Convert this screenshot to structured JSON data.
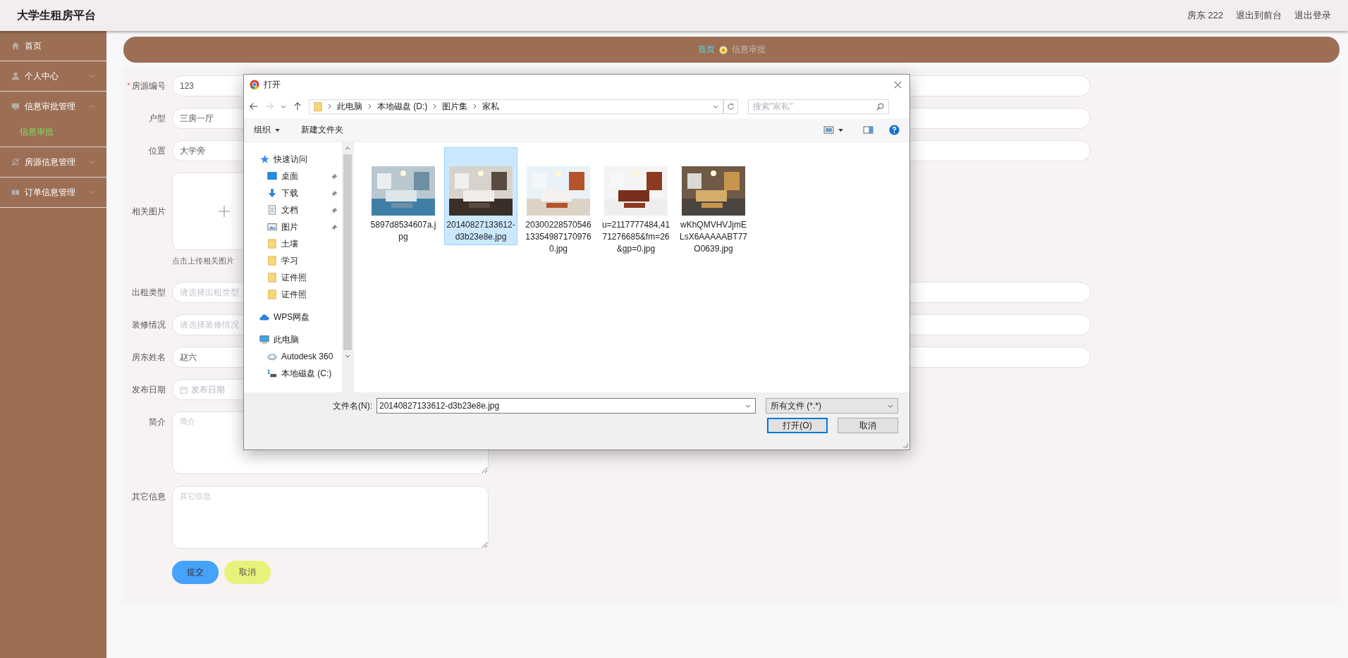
{
  "header": {
    "title": "大学生租房平台",
    "user": "房东 222",
    "links": [
      "退出到前台",
      "退出登录"
    ]
  },
  "sidebar": [
    {
      "label": "首页",
      "kind": "link"
    },
    {
      "label": "个人中心",
      "kind": "menu",
      "expanded": false
    },
    {
      "label": "信息审批管理",
      "kind": "menu",
      "expanded": true,
      "children": [
        {
          "label": "信息审批",
          "selected": true
        }
      ]
    },
    {
      "label": "房源信息管理",
      "kind": "menu",
      "expanded": false
    },
    {
      "label": "订单信息管理",
      "kind": "menu",
      "expanded": false
    }
  ],
  "breadcrumb": [
    {
      "label": "首页",
      "selected": false
    },
    {
      "label": "信息审批",
      "selected": true
    }
  ],
  "form": {
    "fields": [
      {
        "label": "房源编号",
        "kind": "input",
        "required_mark": "*",
        "value": "123"
      },
      {
        "label": "户型",
        "kind": "input",
        "value": "三房一厅"
      },
      {
        "label": "位置",
        "kind": "input",
        "value": "大学旁"
      },
      {
        "label": "相关图片",
        "kind": "upload",
        "hint": "点击上传相关图片"
      },
      {
        "label": "出租类型",
        "kind": "select",
        "placeholder": "请选择出租类型"
      },
      {
        "label": "装修情况",
        "kind": "select",
        "placeholder": "请选择装修情况"
      },
      {
        "label": "房东姓名",
        "kind": "input",
        "value": "赵六"
      },
      {
        "label": "发布日期",
        "kind": "date",
        "placeholder": "发布日期"
      },
      {
        "label": "简介",
        "kind": "textarea",
        "placeholder": "简介"
      },
      {
        "label": "其它信息",
        "kind": "textarea",
        "placeholder": "其它信息"
      }
    ],
    "buttons": [
      {
        "label": "提交",
        "kind": "primary"
      },
      {
        "label": "取消",
        "kind": "cancel"
      }
    ]
  },
  "dialog": {
    "title": "打开",
    "path": [
      "此电脑",
      "本地磁盘 (D:)",
      "图片集",
      "家私"
    ],
    "search_placeholder": "搜索\"家私\"",
    "toolbar": [
      "组织",
      "新建文件夹"
    ],
    "tree": [
      {
        "label": "快速访问",
        "children": [
          {
            "label": "桌面",
            "pinned": true
          },
          {
            "label": "下载",
            "pinned": true
          },
          {
            "label": "文档",
            "pinned": true
          },
          {
            "label": "图片",
            "pinned": true
          },
          {
            "label": "土壤",
            "pinned": false
          },
          {
            "label": "学习",
            "pinned": false
          },
          {
            "label": "证件照",
            "pinned": false
          },
          {
            "label": "证件照",
            "pinned": false
          }
        ]
      },
      {
        "label": "WPS网盘"
      },
      {
        "label": "此电脑",
        "children": [
          {
            "label": "Autodesk 360",
            "pinned": false
          },
          {
            "label": "本地磁盘 (C:)",
            "pinned": false
          }
        ]
      }
    ],
    "files": [
      {
        "name": "5897d8534607a.jpg",
        "selected": false
      },
      {
        "name": "20140827133612-d3b23e8e.jpg",
        "selected": true
      },
      {
        "name": "20300228570546133549871709760.jpg",
        "selected": false
      },
      {
        "name": "u=2117777484,4171276685&fm=26&gp=0.jpg",
        "selected": false
      },
      {
        "name": "wKhQMVHVJjmELsX6AAAAABT77O0639.jpg",
        "selected": false
      }
    ],
    "filename_label": "文件名(N):",
    "filename": "20140827133612-d3b23e8e.jpg",
    "filter": "所有文件 (*.*)",
    "buttons": [
      {
        "label": "打开(O)",
        "kind": "default"
      },
      {
        "label": "取消",
        "kind": "normal"
      }
    ]
  }
}
